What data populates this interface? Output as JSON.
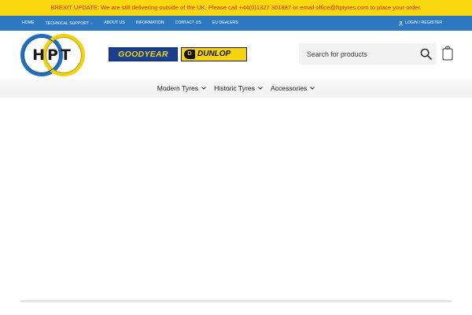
{
  "announcement": "BREXIT UPDATE: We are still delivering outside of the UK. Please call +44(0)1327 301887 or email office@hptyres.com to place your order.",
  "top_nav": {
    "links": [
      "HOME",
      "TECHNICAL SUPPORT",
      "ABOUT US",
      "INFORMATION",
      "CONTACT US",
      "EU DEALERS"
    ],
    "login": "LOGIN / REGISTER"
  },
  "logo": {
    "text": "HPT"
  },
  "brands": {
    "goodyear": "GOODYEAR",
    "dunlop": "DUNLOP"
  },
  "search": {
    "placeholder": "Search for products"
  },
  "cart": {
    "count": "0"
  },
  "main_nav": {
    "items": [
      "Modern Tyres",
      "Historic Tyres",
      "Accessories"
    ]
  },
  "colors": {
    "announcement_bg": "#f8d90f",
    "announcement_text": "#e5281c",
    "topnav_bg": "#2e78c2",
    "goodyear_blue": "#1a3f8f",
    "brand_yellow": "#f5d40c"
  }
}
